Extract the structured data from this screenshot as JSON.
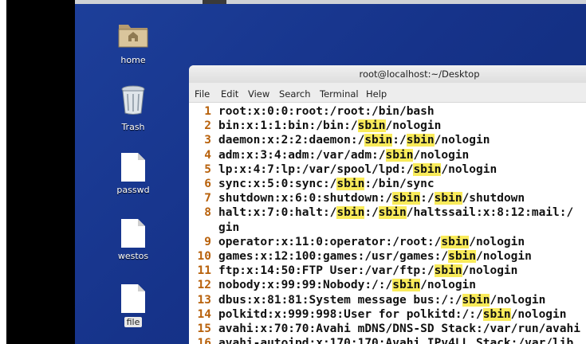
{
  "desktop": {
    "icons": [
      {
        "name": "home",
        "type": "folder"
      },
      {
        "name": "Trash",
        "type": "trash"
      },
      {
        "name": "passwd",
        "type": "file"
      },
      {
        "name": "westos",
        "type": "file"
      },
      {
        "name": "file",
        "type": "file",
        "selected": true
      }
    ]
  },
  "terminal": {
    "title": "root@localhost:~/Desktop",
    "menu": [
      "File",
      "Edit",
      "View",
      "Search",
      "Terminal",
      "Help"
    ],
    "highlight_term": "sbin",
    "highlight_color": "#f9eb5a",
    "lines": [
      {
        "n": "1",
        "parts": [
          "root:x:0:0:root:/root:/bin/bash"
        ]
      },
      {
        "n": "2",
        "parts": [
          "bin:x:1:1:bin:/bin:/",
          "sbin",
          "/nologin"
        ]
      },
      {
        "n": "3",
        "parts": [
          "daemon:x:2:2:daemon:/",
          "sbin",
          ":/",
          "sbin",
          "/nologin"
        ]
      },
      {
        "n": "4",
        "parts": [
          "adm:x:3:4:adm:/var/adm:/",
          "sbin",
          "/nologin"
        ]
      },
      {
        "n": "5",
        "parts": [
          "lp:x:4:7:lp:/var/spool/lpd:/",
          "sbin",
          "/nologin"
        ]
      },
      {
        "n": "6",
        "parts": [
          "sync:x:5:0:sync:/",
          "sbin",
          ":/bin/sync"
        ]
      },
      {
        "n": "7",
        "parts": [
          "shutdown:x:6:0:shutdown:/",
          "sbin",
          ":/",
          "sbin",
          "/shutdown"
        ]
      },
      {
        "n": "8",
        "parts": [
          "halt:x:7:0:halt:/",
          "sbin",
          ":/",
          "sbin",
          "/haltssail:x:8:12:mail:/"
        ]
      },
      {
        "n": "",
        "parts": [
          "gin"
        ]
      },
      {
        "n": "9",
        "parts": [
          "operator:x:11:0:operator:/root:/",
          "sbin",
          "/nologin"
        ]
      },
      {
        "n": "10",
        "parts": [
          "games:x:12:100:games:/usr/games:/",
          "sbin",
          "/nologin"
        ]
      },
      {
        "n": "11",
        "parts": [
          "ftp:x:14:50:FTP User:/var/ftp:/",
          "sbin",
          "/nologin"
        ]
      },
      {
        "n": "12",
        "parts": [
          "nobody:x:99:99:Nobody:/:/",
          "sbin",
          "/nologin"
        ]
      },
      {
        "n": "13",
        "parts": [
          "dbus:x:81:81:System message bus:/:/",
          "sbin",
          "/nologin"
        ]
      },
      {
        "n": "14",
        "parts": [
          "polkitd:x:999:998:User for polkitd:/:/",
          "sbin",
          "/nologin"
        ]
      },
      {
        "n": "15",
        "parts": [
          "avahi:x:70:70:Avahi mDNS/DNS-SD Stack:/var/run/avahi"
        ]
      },
      {
        "n": "16",
        "parts": [
          "avahi-autoipd:x:170:170:Avahi IPv4LL Stack:/var/lib"
        ]
      }
    ]
  }
}
